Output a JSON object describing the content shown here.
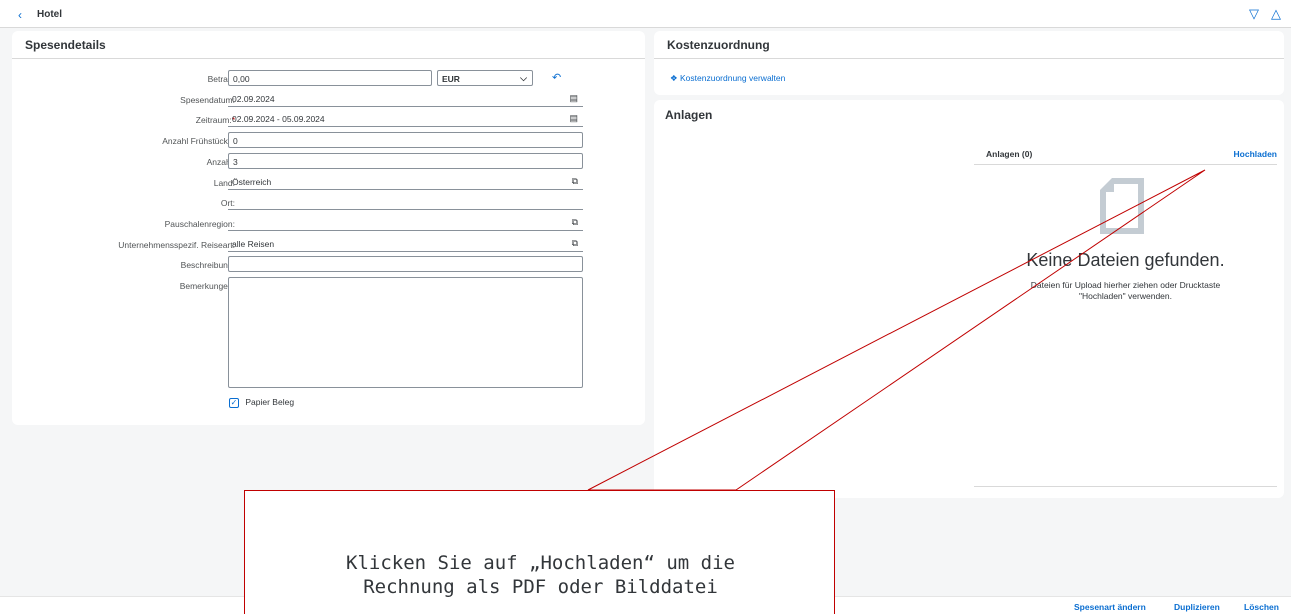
{
  "header": {
    "back_icon": "chevron-left-icon",
    "title": "Hotel",
    "nav_down_icon": "triangle-down-icon",
    "nav_up_icon": "triangle-up-icon"
  },
  "spesendetails": {
    "title": "Spesendetails",
    "fields": {
      "betrag": {
        "label": "Betrag:",
        "value": "0,00",
        "currency": "EUR"
      },
      "spesendatum": {
        "label": "Spesendatum:",
        "value": "02.09.2024"
      },
      "zeitraum": {
        "label": "Zeitraum:",
        "required_mark": "*",
        "value": "02.09.2024  -  05.09.2024"
      },
      "fruehstuecke": {
        "label": "Anzahl Frühstücke:",
        "value": "0"
      },
      "anzahl": {
        "label": "Anzahl:",
        "value": "3"
      },
      "land": {
        "label": "Land:",
        "value": "Österreich"
      },
      "ort": {
        "label": "Ort:",
        "value": ""
      },
      "pauschalenregion": {
        "label": "Pauschalenregion:",
        "value": ""
      },
      "reiseart": {
        "label": "Unternehmensspezif. Reiseart:",
        "value": "alle Reisen"
      },
      "beschreibung": {
        "label": "Beschreibung:",
        "value": ""
      },
      "bemerkungen": {
        "label": "Bemerkungen:",
        "value": ""
      }
    },
    "papier_beleg": {
      "label": "Papier Beleg",
      "checked": true
    }
  },
  "kostenzuordnung": {
    "title": "Kostenzuordnung",
    "link": "Kostenzuordnung verwalten"
  },
  "anlagen": {
    "title": "Anlagen",
    "list_title": "Anlagen (0)",
    "upload": "Hochladen",
    "empty_title": "Keine Dateien gefunden.",
    "empty_desc_1": "Dateien für Upload hierher ziehen oder Drucktaste",
    "empty_desc_2": "\"Hochladen\" verwenden."
  },
  "footer": {
    "change_type": "Spesenart ändern",
    "duplicate": "Duplizieren",
    "delete": "Löschen"
  },
  "callout": {
    "line1": "Klicken Sie auf „Hochladen“ um die",
    "line2": "Rechnung als PDF oder Bilddatei"
  },
  "colors": {
    "accent": "#0a6ed1",
    "callout_border": "#c00000",
    "required": "#bb0000"
  }
}
